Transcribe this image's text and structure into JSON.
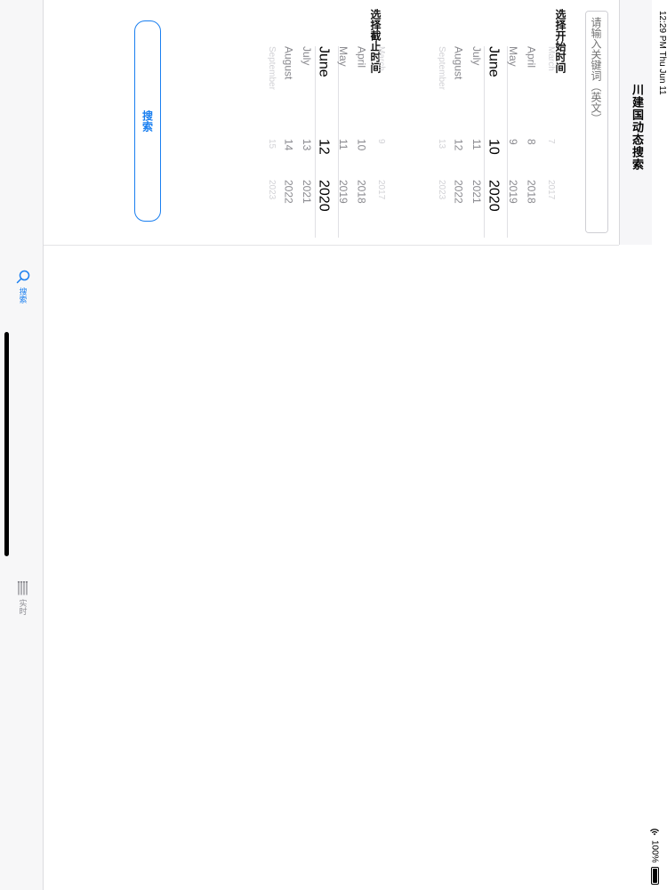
{
  "status_bar": {
    "time_date": "12:29 PM   Thu Jun 11",
    "battery": "100%"
  },
  "nav": {
    "title": "川建国动态搜索"
  },
  "form": {
    "keyword_placeholder": "请输入关键词（英文）",
    "start_label": "选择开始时间",
    "end_label": "选择截止时间",
    "start_picker": {
      "months": [
        "March",
        "April",
        "May",
        "June",
        "July",
        "August",
        "September"
      ],
      "days": [
        "7",
        "8",
        "9",
        "10",
        "11",
        "12",
        "13"
      ],
      "years": [
        "2017",
        "2018",
        "2019",
        "2020",
        "2021",
        "2022",
        "2023"
      ],
      "selected": {
        "month": "June",
        "day": "10",
        "year": "2020"
      }
    },
    "end_picker": {
      "months": [
        "March",
        "April",
        "May",
        "June",
        "July",
        "August",
        "September"
      ],
      "days": [
        "9",
        "10",
        "11",
        "12",
        "13",
        "14",
        "15"
      ],
      "years": [
        "2017",
        "2018",
        "2019",
        "2020",
        "2021",
        "2022",
        "2023"
      ],
      "selected": {
        "month": "June",
        "day": "12",
        "year": "2020"
      }
    },
    "search_button_label": "搜索"
  },
  "tab_bar": {
    "items": [
      {
        "label": "搜索",
        "icon": "search-icon",
        "active": true
      },
      {
        "label": "实时",
        "icon": "list-icon",
        "active": false
      }
    ]
  },
  "colors": {
    "accent": "#1a7ff0",
    "nav_background": "#f6f6f8",
    "tab_background": "#f7f7f8"
  }
}
